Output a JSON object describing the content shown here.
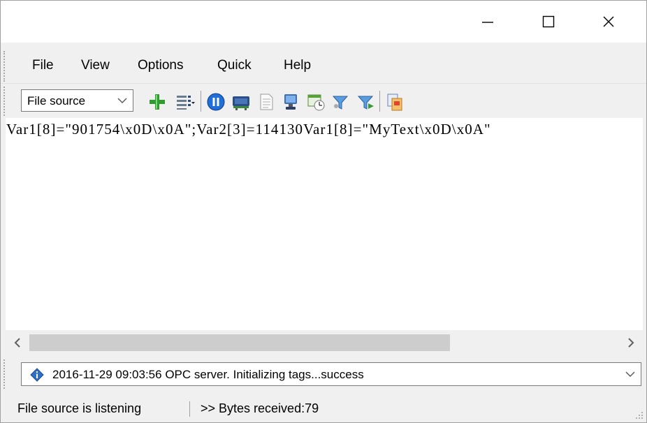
{
  "window": {
    "minimize_label": "Minimize",
    "maximize_label": "Maximize",
    "close_label": "Close"
  },
  "menu": {
    "items": [
      {
        "label": "File"
      },
      {
        "label": "View"
      },
      {
        "label": "Options"
      },
      {
        "label": "Quick"
      },
      {
        "label": "Help"
      }
    ]
  },
  "toolbar": {
    "source_select": {
      "value": "File source"
    },
    "icons": [
      "add-icon",
      "columns-icon",
      "pause-icon",
      "port-icon",
      "document-icon",
      "computer-icon",
      "timer-icon",
      "filter-icon",
      "filter-arrow-icon",
      "copy-icon"
    ]
  },
  "content": {
    "text": "Var1[8]=\"901754\\x0D\\x0A\";Var2[3]=114130Var1[8]=\"MyText\\x0D\\x0A\""
  },
  "log": {
    "message": "2016-11-29 09:03:56 OPC server. Initializing tags...success"
  },
  "status": {
    "left": "File source is listening",
    "right": ">> Bytes received:79"
  },
  "colors": {
    "window_bg": "#f0f0f0",
    "content_bg": "#ffffff",
    "scroll_thumb": "#cdcdcd",
    "accent_blue": "#1f6fd6"
  }
}
